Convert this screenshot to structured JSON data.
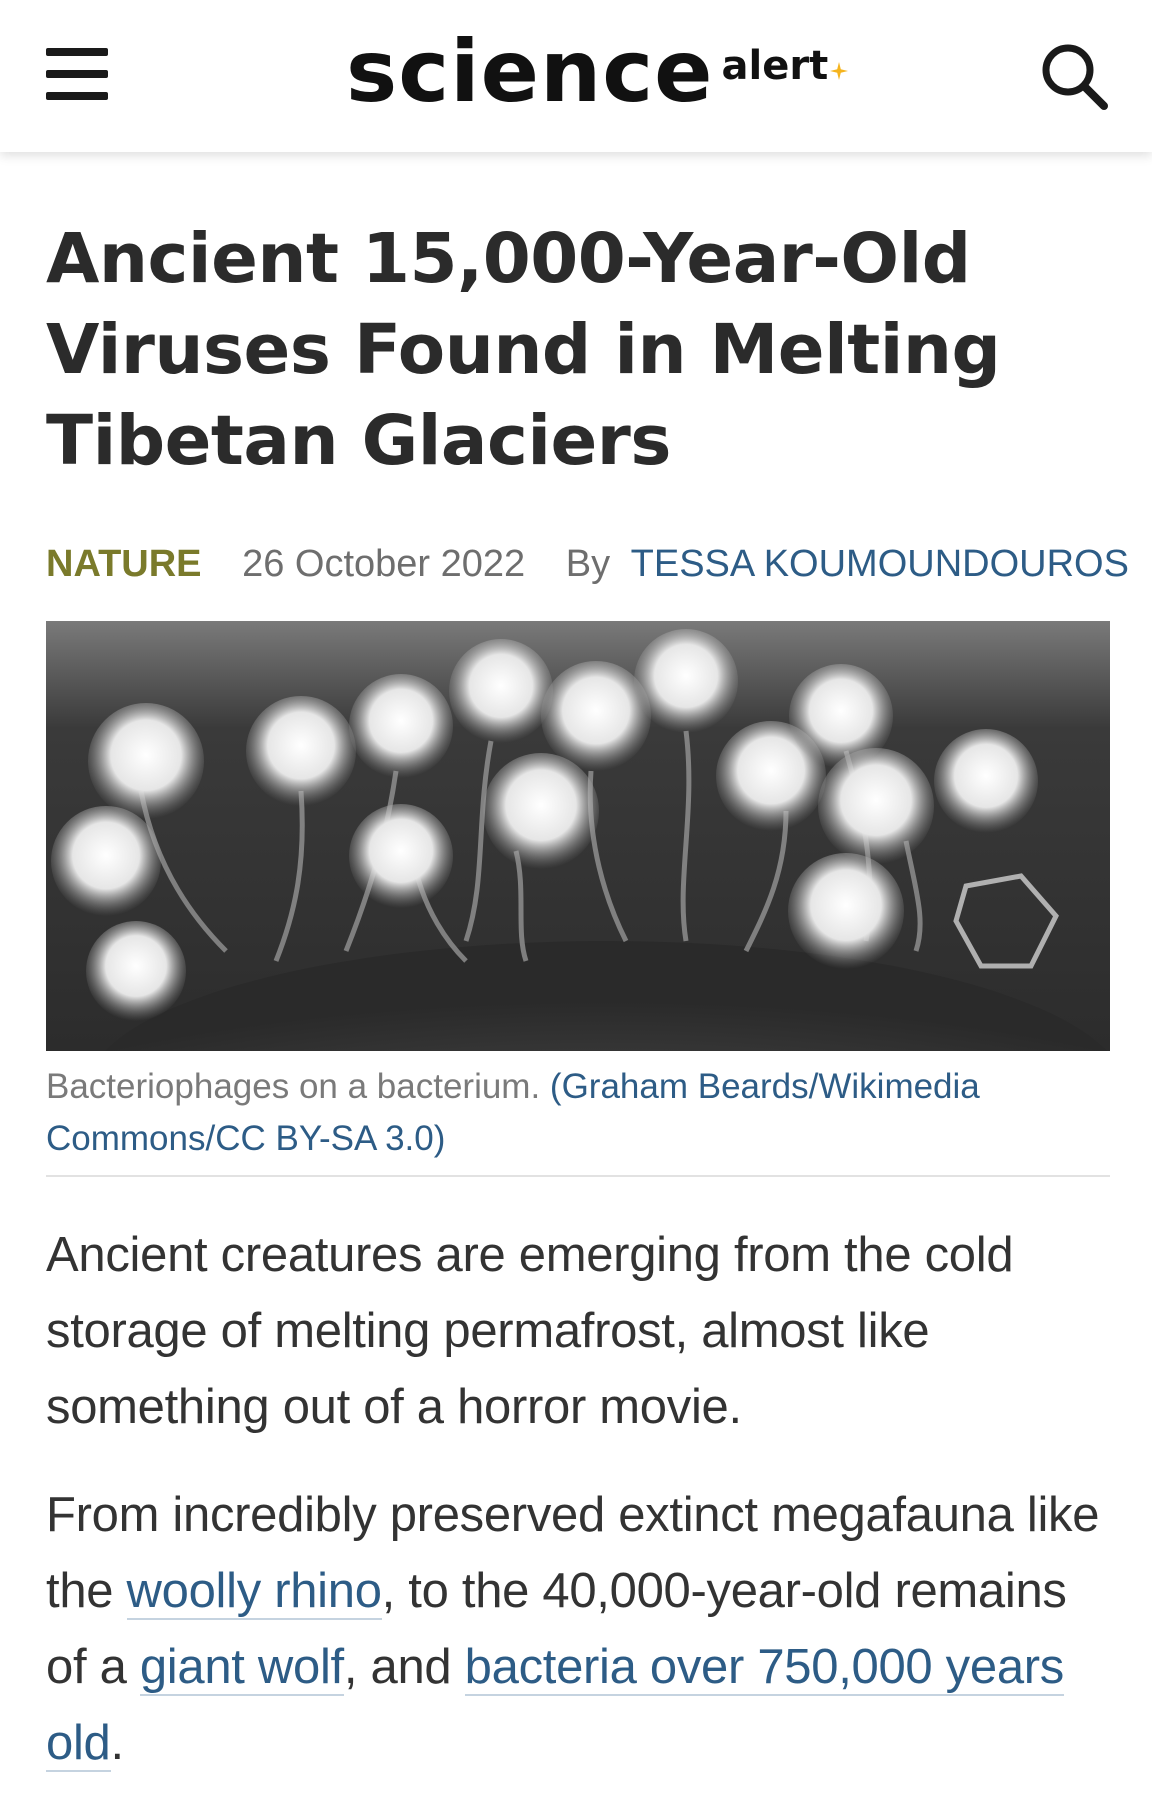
{
  "header": {
    "logo_main": "science",
    "logo_sub": "alert",
    "accent_color": "#f5b41e"
  },
  "article": {
    "title": "Ancient 15,000-Year-Old Viruses Found in Melting Tibetan Glaciers",
    "category": "NATURE",
    "date": "26 October 2022",
    "by_label": "By",
    "author": "TESSA KOUMOUNDOUROS",
    "image": {
      "caption_text": "Bacteriophages on a bacterium.",
      "caption_credit": "(Graham Beards/Wikimedia Commons/CC BY-SA 3.0)"
    },
    "paragraph1": "Ancient creatures are emerging from the cold storage of melting permafrost, almost like something out of a horror movie.",
    "paragraph2": {
      "t1": "From incredibly preserved extinct megafauna like the ",
      "link1": "woolly rhino",
      "t2": ", to the 40,000-year-old remains of a ",
      "link2": "giant wolf",
      "t3": ", and ",
      "link3": "bacteria over 750,000 years old",
      "t4": "."
    }
  },
  "colors": {
    "category": "#7a7a2b",
    "link": "#2d5c86",
    "text": "#333333"
  }
}
